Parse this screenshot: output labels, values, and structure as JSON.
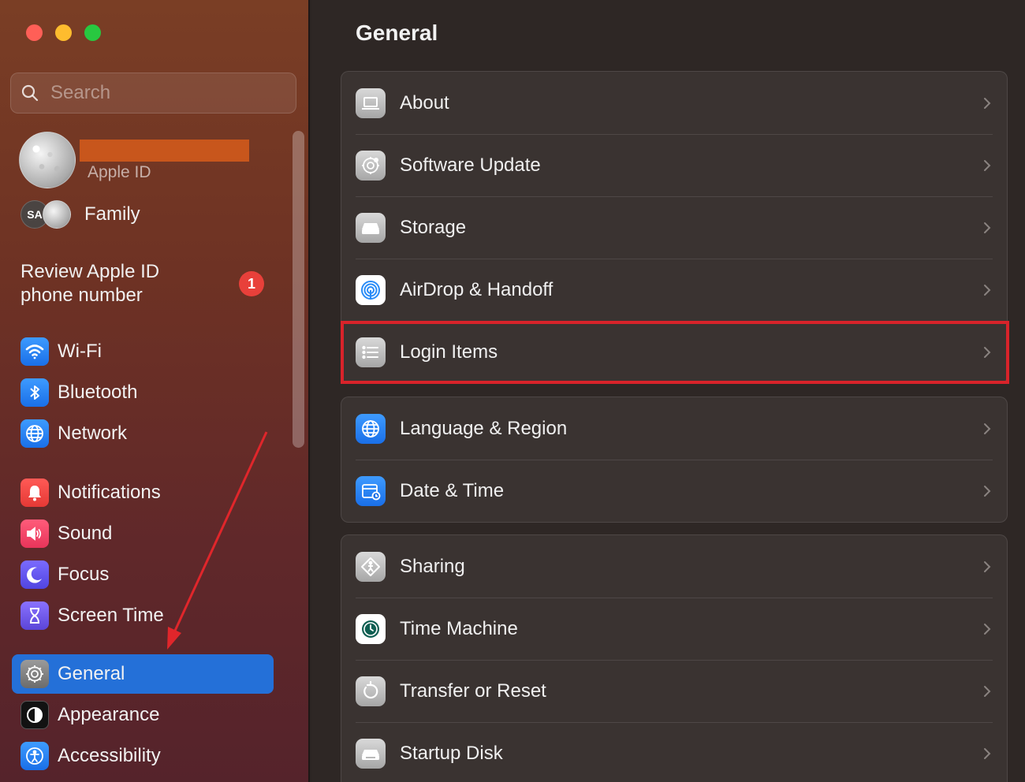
{
  "window": {
    "title": "General",
    "traffic_lights": {
      "close": "#ff5f57",
      "minimize": "#febc2e",
      "maximize": "#28c840"
    }
  },
  "sidebar": {
    "search_placeholder": "Search",
    "profile": {
      "subtitle": "Apple ID"
    },
    "family": {
      "initials": "SA",
      "label": "Family"
    },
    "review": {
      "text": "Review Apple ID phone number",
      "badge": "1"
    },
    "items": [
      {
        "label": "Wi-Fi",
        "icon": "wifi-icon"
      },
      {
        "label": "Bluetooth",
        "icon": "bluetooth-icon"
      },
      {
        "label": "Network",
        "icon": "network-globe-icon"
      },
      {
        "label": "Notifications",
        "icon": "bell-icon"
      },
      {
        "label": "Sound",
        "icon": "speaker-icon"
      },
      {
        "label": "Focus",
        "icon": "moon-icon"
      },
      {
        "label": "Screen Time",
        "icon": "hourglass-icon"
      },
      {
        "label": "General",
        "icon": "gear-icon",
        "selected": true
      },
      {
        "label": "Appearance",
        "icon": "appearance-icon"
      },
      {
        "label": "Accessibility",
        "icon": "accessibility-icon"
      }
    ],
    "accent": "#2470d8"
  },
  "main": {
    "title": "General",
    "groups": [
      {
        "rows": [
          {
            "label": "About",
            "icon": "laptop-icon"
          },
          {
            "label": "Software Update",
            "icon": "gear-badge-icon"
          },
          {
            "label": "Storage",
            "icon": "drive-icon"
          },
          {
            "label": "AirDrop & Handoff",
            "icon": "airdrop-icon"
          },
          {
            "label": "Login Items",
            "icon": "list-icon",
            "highlighted": true
          }
        ]
      },
      {
        "rows": [
          {
            "label": "Language & Region",
            "icon": "globe-icon"
          },
          {
            "label": "Date & Time",
            "icon": "calendar-clock-icon"
          }
        ]
      },
      {
        "rows": [
          {
            "label": "Sharing",
            "icon": "sharing-icon"
          },
          {
            "label": "Time Machine",
            "icon": "time-machine-icon"
          },
          {
            "label": "Transfer or Reset",
            "icon": "reset-icon"
          },
          {
            "label": "Startup Disk",
            "icon": "disk-icon"
          }
        ]
      }
    ],
    "highlight_color": "#d8232a"
  }
}
